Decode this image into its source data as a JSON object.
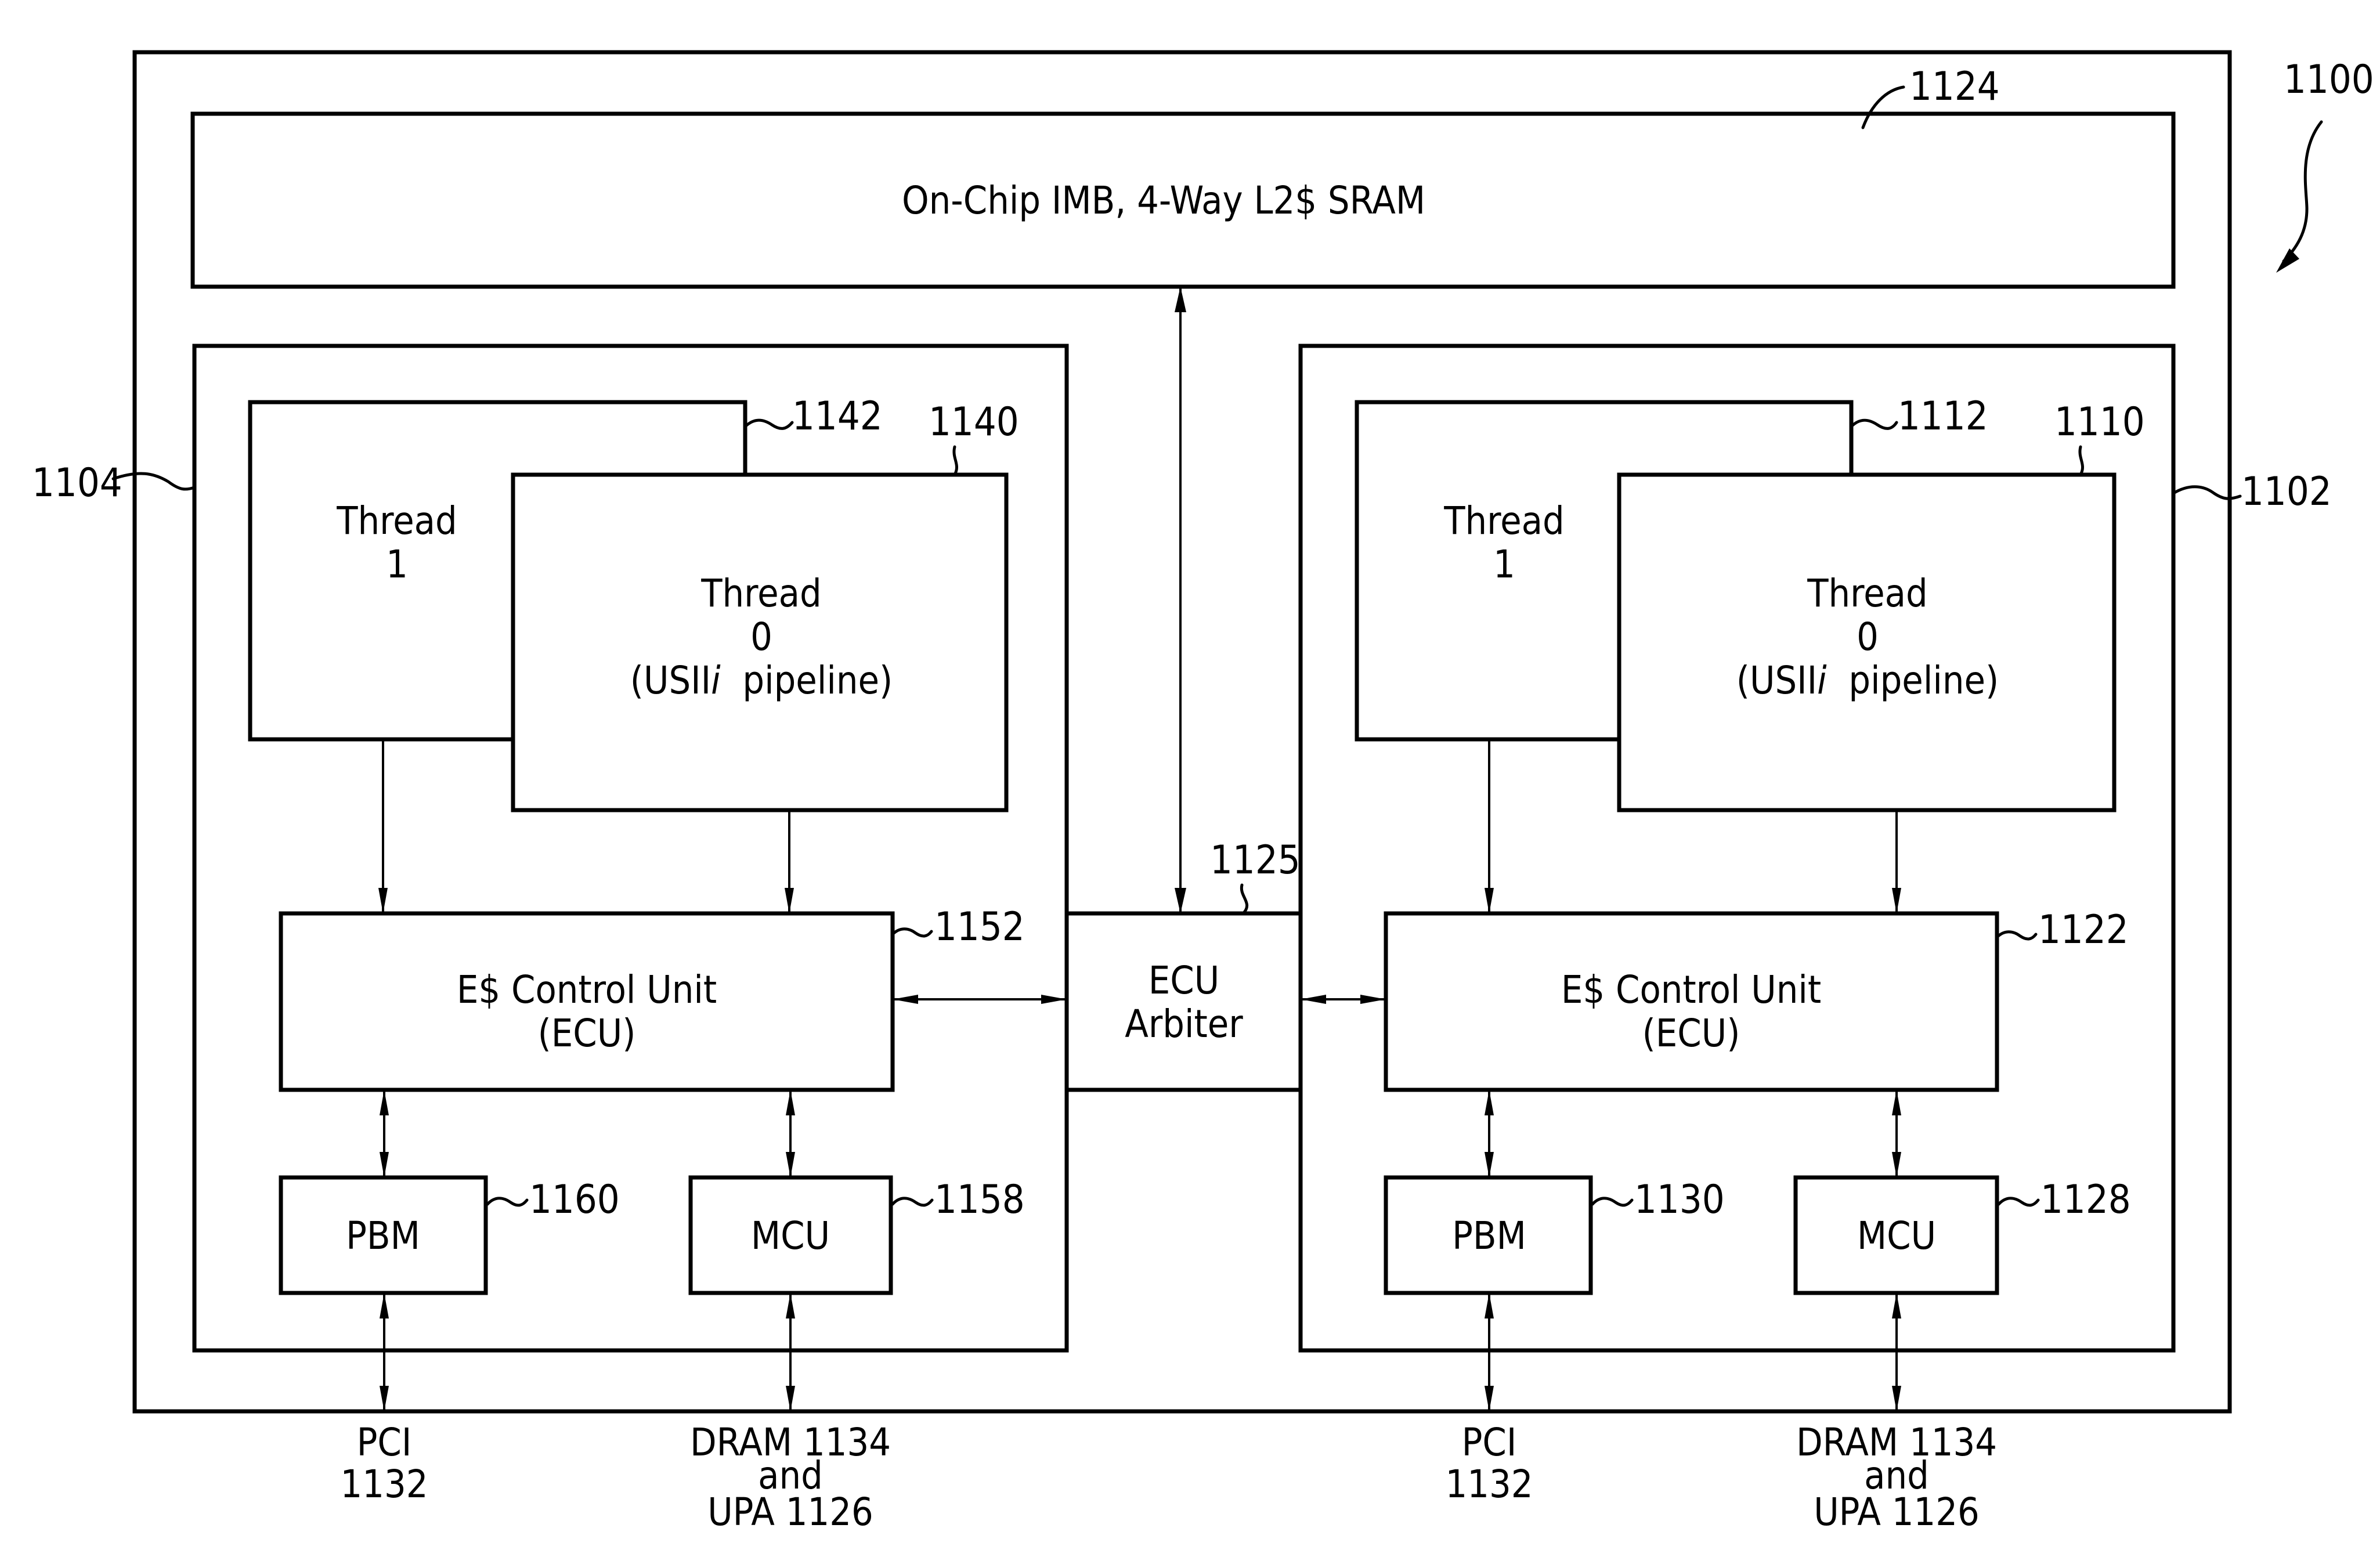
{
  "figure": {
    "reference": "1100",
    "l2_cache": {
      "label": "On-Chip IMB, 4-Way L2$ SRAM",
      "ref": "1124"
    },
    "arbiter": {
      "line1": "ECU",
      "line2": "Arbiter",
      "ref": "1125"
    },
    "left_core": {
      "ref": "1104",
      "thread1": {
        "line1": "Thread",
        "line2": "1",
        "ref": "1142"
      },
      "thread0": {
        "line1": "Thread",
        "line2": "0",
        "line3_pre": "(USII",
        "line3_italic": "i",
        "line3_post": "  pipeline)",
        "ref": "1140"
      },
      "ecu": {
        "line1": "E$ Control Unit",
        "line2": "(ECU)",
        "ref": "1152"
      },
      "pbm": {
        "label": "PBM",
        "ref": "1160"
      },
      "mcu": {
        "label": "MCU",
        "ref": "1158"
      },
      "pci": {
        "line1": "PCI",
        "line2": "1132"
      },
      "dram": {
        "line1": "DRAM 1134",
        "line2": "and",
        "line3": "UPA 1126"
      }
    },
    "right_core": {
      "ref": "1102",
      "thread1": {
        "line1": "Thread",
        "line2": "1",
        "ref": "1112"
      },
      "thread0": {
        "line1": "Thread",
        "line2": "0",
        "line3_pre": "(USII",
        "line3_italic": "i",
        "line3_post": "  pipeline)",
        "ref": "1110"
      },
      "ecu": {
        "line1": "E$ Control Unit",
        "line2": "(ECU)",
        "ref": "1122"
      },
      "pbm": {
        "label": "PBM",
        "ref": "1130"
      },
      "mcu": {
        "label": "MCU",
        "ref": "1128"
      },
      "pci": {
        "line1": "PCI",
        "line2": "1132"
      },
      "dram": {
        "line1": "DRAM 1134",
        "line2": "and",
        "line3": "UPA 1126"
      }
    }
  }
}
